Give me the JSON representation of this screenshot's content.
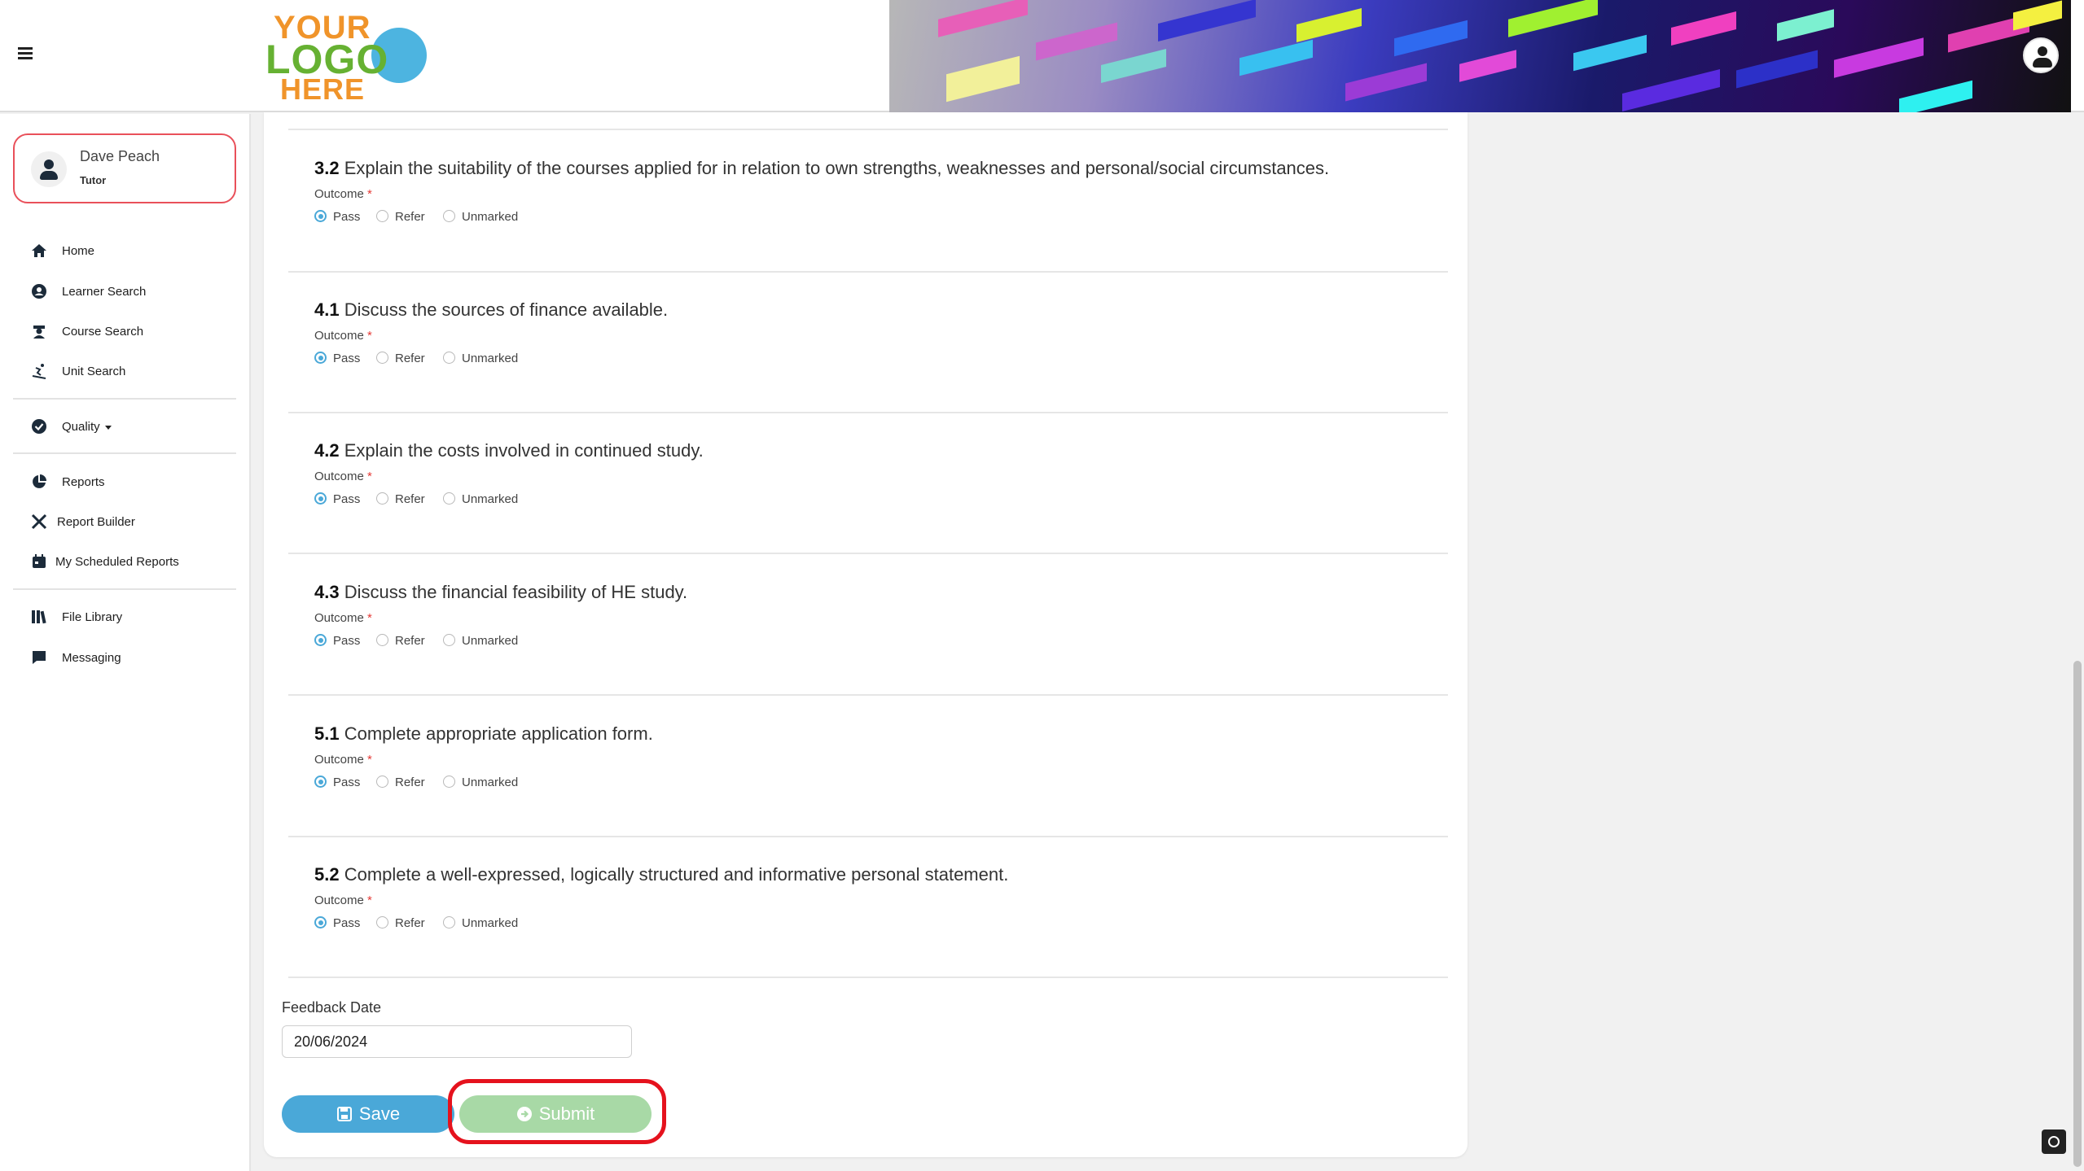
{
  "header": {
    "logo": {
      "line1": "YOUR",
      "line2": "LOGO",
      "line3": "HERE"
    }
  },
  "sidebar": {
    "user": {
      "name": "Dave Peach",
      "role": "Tutor"
    },
    "items": [
      {
        "label": "Home",
        "icon": "home-icon"
      },
      {
        "label": "Learner Search",
        "icon": "user-circle-icon"
      },
      {
        "label": "Course Search",
        "icon": "graduate-icon"
      },
      {
        "label": "Unit Search",
        "icon": "skiing-icon"
      },
      {
        "label": "Quality",
        "icon": "check-circle-icon"
      },
      {
        "label": "Reports",
        "icon": "pie-chart-icon"
      },
      {
        "label": "Report Builder",
        "icon": "tools-icon"
      },
      {
        "label": "My Scheduled Reports",
        "icon": "calendar-icon"
      },
      {
        "label": "File Library",
        "icon": "books-icon"
      },
      {
        "label": "Messaging",
        "icon": "chat-icon"
      }
    ]
  },
  "form": {
    "outcome_label": "Outcome",
    "required_mark": "*",
    "options": [
      "Pass",
      "Refer",
      "Unmarked"
    ],
    "questions": [
      {
        "num": "3.2",
        "text": "Explain the suitability of the courses applied for in relation to own strengths, weaknesses and personal/social circumstances.",
        "selected": "Pass"
      },
      {
        "num": "4.1",
        "text": "Discuss the sources of finance available.",
        "selected": "Pass"
      },
      {
        "num": "4.2",
        "text": "Explain the costs involved in continued study.",
        "selected": "Pass"
      },
      {
        "num": "4.3",
        "text": "Discuss the financial feasibility of HE study.",
        "selected": "Pass"
      },
      {
        "num": "5.1",
        "text": "Complete appropriate application form.",
        "selected": "Pass"
      },
      {
        "num": "5.2",
        "text": "Complete a well-expressed, logically structured and informative personal statement.",
        "selected": "Pass"
      }
    ],
    "feedback_date_label": "Feedback Date",
    "feedback_date_value": "20/06/2024",
    "save_label": "Save",
    "submit_label": "Submit"
  },
  "colors": {
    "accent": "#4aa8d8",
    "submit": "#a8d9a6",
    "highlight": "#e5121d",
    "user_border": "#e9505a",
    "logo_orange": "#f0942a",
    "logo_green": "#66b132"
  }
}
